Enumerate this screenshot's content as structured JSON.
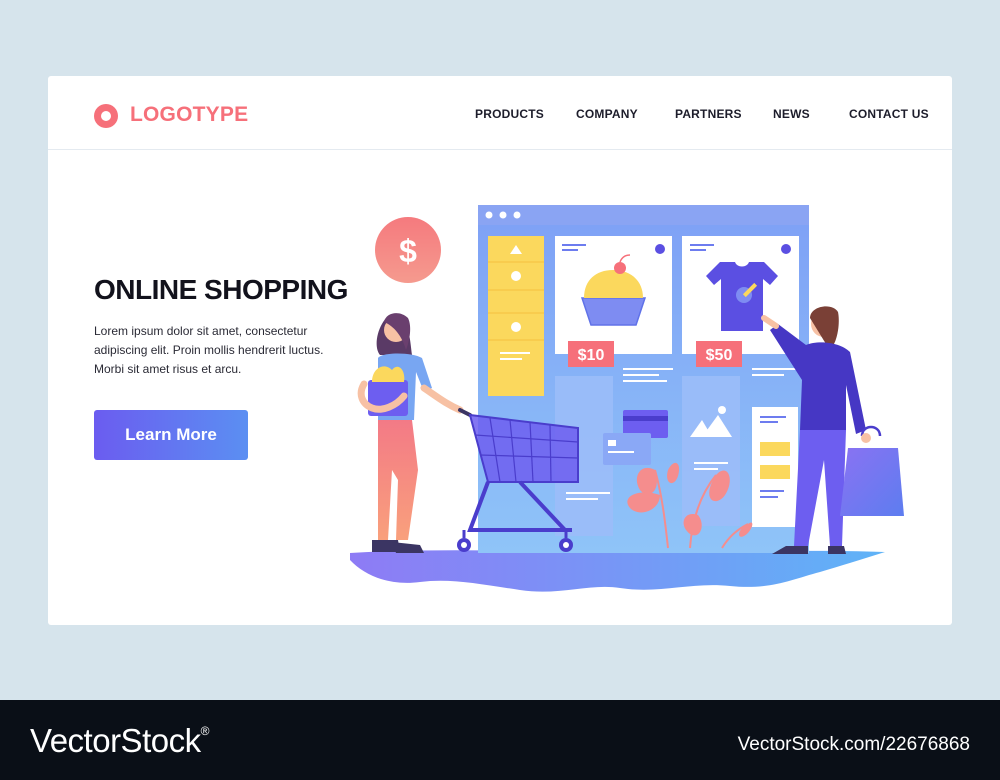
{
  "header": {
    "logo_text": "LOGOTYPE",
    "nav": [
      "PRODUCTS",
      "COMPANY",
      "PARTNERS",
      "NEWS",
      "CONTACT US"
    ]
  },
  "hero": {
    "title": "ONLINE SHOPPING",
    "body": "Lorem ipsum dolor sit amet, consectetur adipiscing elit. Proin mollis hendrerit luctus. Morbi sit amet risus et arcu.",
    "cta_label": "Learn More"
  },
  "illustration": {
    "dollar_symbol": "$",
    "price_1": "$10",
    "price_2": "$50"
  },
  "watermark": {
    "brand": "VectorStock",
    "trademark": "®",
    "id_text": "VectorStock.com/22676868"
  },
  "colors": {
    "background": "#d6e4ec",
    "accent_coral": "#f6707a",
    "button_start": "#6b5cf0",
    "button_end": "#5b8ff2",
    "footer": "#0a0f17"
  },
  "icons": [
    "dollar-coin-icon",
    "cupcake-icon",
    "tshirt-icon",
    "shopping-cart-icon",
    "credit-card-icon",
    "image-icon",
    "shopping-bag-icon"
  ]
}
